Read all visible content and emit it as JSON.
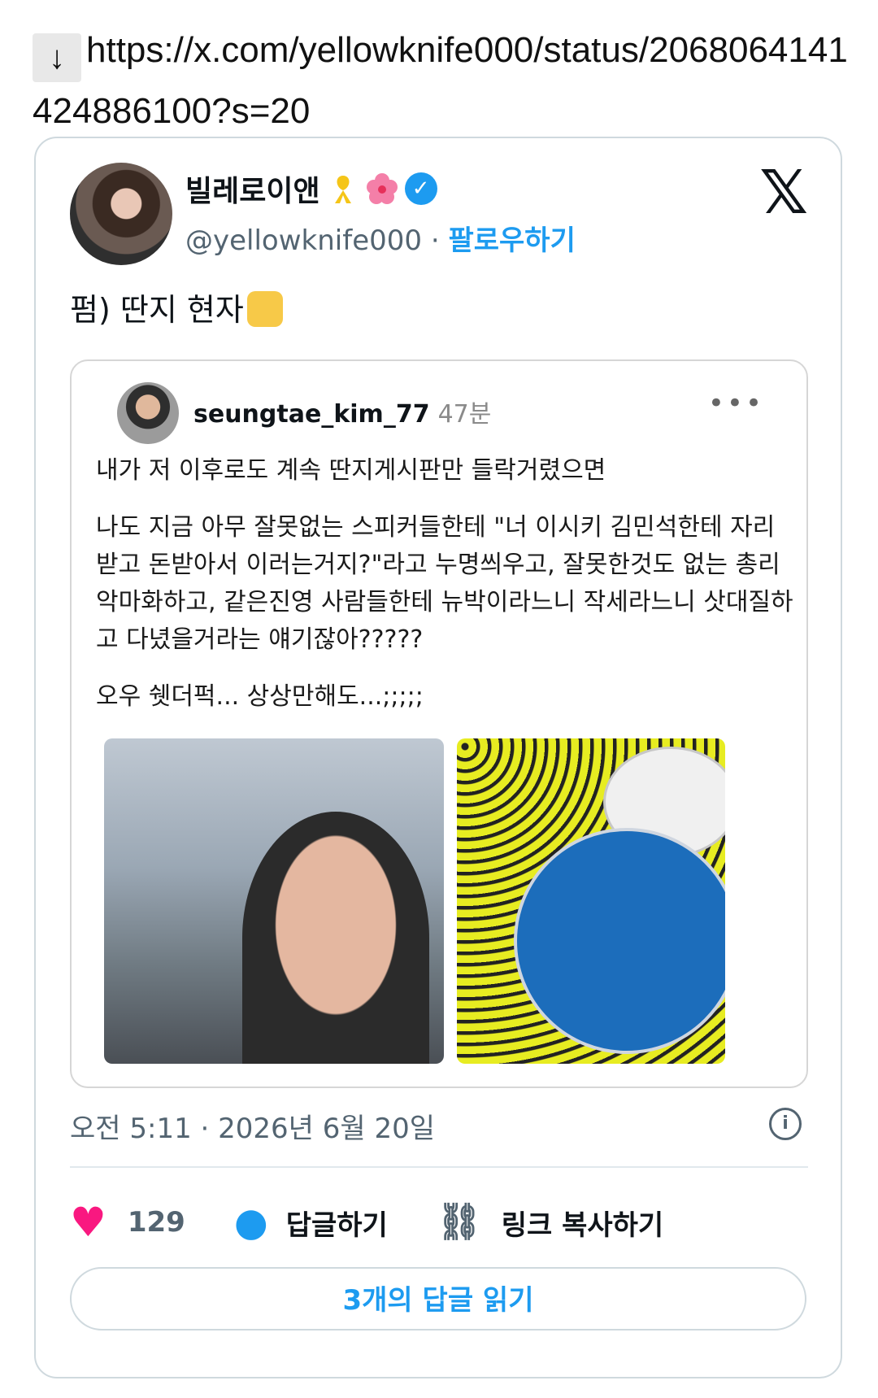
{
  "url": {
    "arrow": "↓",
    "text": "https://x.com/yellowknife000/status/2068064141424886100?s=20"
  },
  "tweet": {
    "author": {
      "display_name": "빌레로이앤",
      "handle": "@yellowknife000",
      "separator": "·",
      "follow_label": "팔로우하기",
      "badge_icon": "verified-check-icon",
      "emoji_icons": [
        "yellow-ribbon-icon",
        "hibiscus-icon"
      ]
    },
    "logo": "𝕏",
    "text": "펌) 딴지 현자",
    "text_emoji_icon": "thumbs-up-icon",
    "quoted": {
      "username": "seungtae_kim_77",
      "time": "47분",
      "more": "•••",
      "paragraphs": [
        "내가 저 이후로도 계속 딴지게시판만 들락거렸으면",
        "나도 지금 아무 잘못없는 스피커들한테 \"너 이시키 김민석한테 자리받고 돈받아서 이러는거지?\"라고 누명씌우고, 잘못한것도 없는 총리 악마화하고, 같은진영 사람들한테 뉴박이라느니 작세라느니 삿대질하고 다녔을거라는 얘기잖아?????",
        "오우 쉣더퍽... 상상만해도...;;;;;"
      ]
    },
    "timestamp": "오전 5:11 · 2026년 6월 20일",
    "likes": "129",
    "reply_label": "답글하기",
    "copy_link_label": "링크 복사하기",
    "read_replies_label": "3개의 답글 읽기"
  },
  "colors": {
    "accent": "#1d9bf0",
    "like": "#f91880",
    "secondary_text": "#536471"
  }
}
